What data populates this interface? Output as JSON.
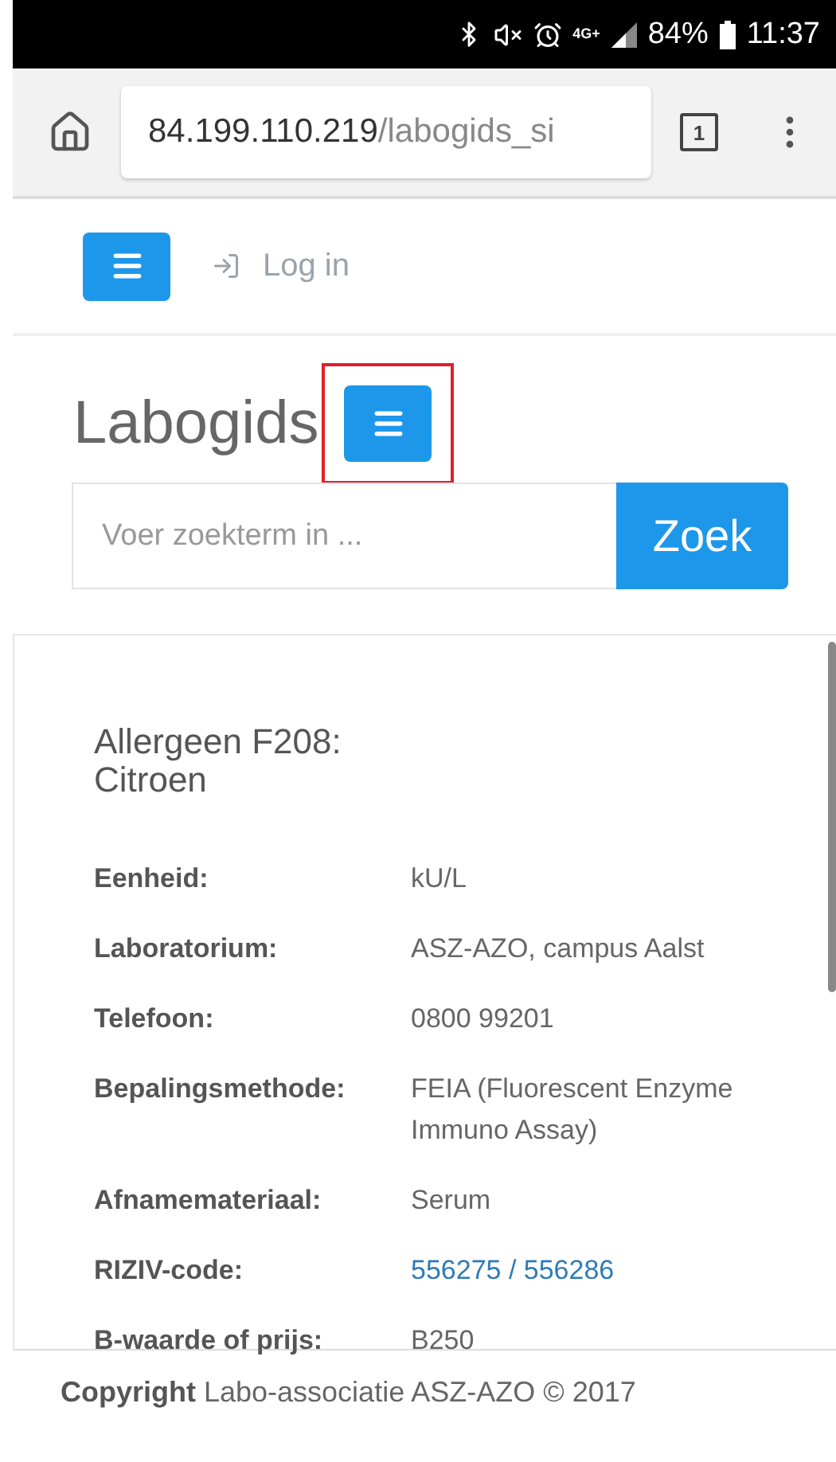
{
  "status_bar": {
    "network": "4G+",
    "battery": "84%",
    "time": "11:37"
  },
  "browser": {
    "url_host": "84.199.110.219",
    "url_path": "/labogids_si",
    "tab_count": "1"
  },
  "nav": {
    "login": "Log in"
  },
  "header": {
    "title": "Labogids",
    "menu_highlighted": true
  },
  "search": {
    "placeholder": "Voer zoekterm in ...",
    "button": "Zoek"
  },
  "detail": {
    "title": "Allergeen F208: Citroen",
    "fields": [
      {
        "label": "Eenheid:",
        "value": "kU/L",
        "kind": "text"
      },
      {
        "label": "Laboratorium:",
        "value": "ASZ-AZO, campus Aalst",
        "kind": "text"
      },
      {
        "label": "Telefoon:",
        "value": "0800 99201",
        "kind": "text"
      },
      {
        "label": "Bepalingsmethode:",
        "value": "FEIA (Fluorescent Enzyme Immuno Assay)",
        "kind": "text"
      },
      {
        "label": "Afnamemateriaal:",
        "value": "Serum",
        "kind": "text"
      },
      {
        "label": "RIZIV-code:",
        "value": "556275 / 556286",
        "kind": "link"
      },
      {
        "label": "B-waarde of prijs:",
        "value": "B250",
        "kind": "text"
      }
    ]
  },
  "footer": {
    "text": "**Copyright** Labo-associatie ASZ-AZO © 2017"
  }
}
